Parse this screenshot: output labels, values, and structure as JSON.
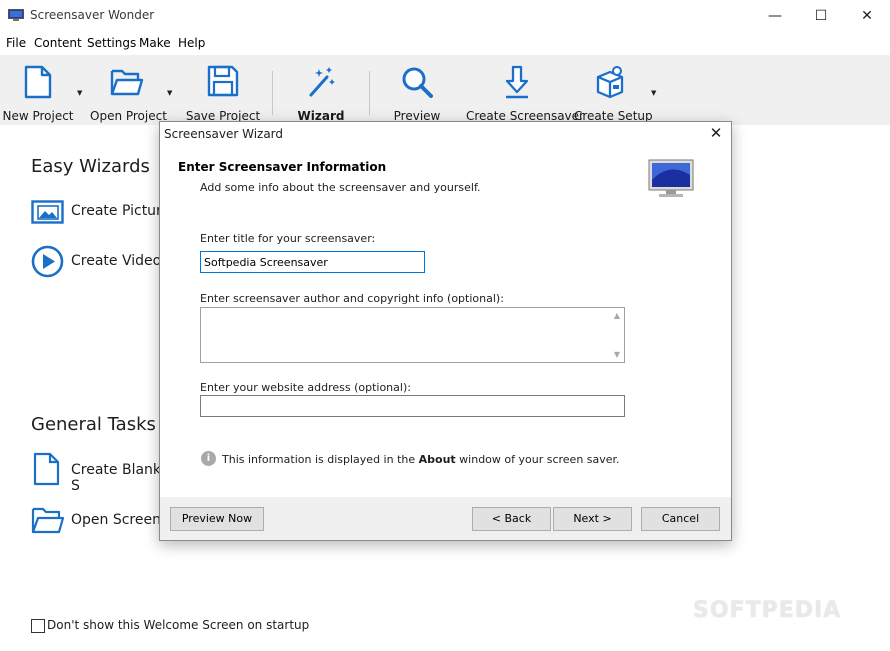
{
  "window": {
    "title": "Screensaver Wonder",
    "minimize_glyph": "—",
    "maximize_glyph": "☐",
    "close_glyph": "✕"
  },
  "menu": [
    "File",
    "Content",
    "Settings",
    "Make",
    "Help"
  ],
  "toolbar": {
    "new_project": "New Project",
    "open_project": "Open Project",
    "save_project": "Save Project",
    "wizard": "Wizard",
    "preview": "Preview",
    "create_screensaver": "Create Screensaver",
    "create_setup": "Create Setup",
    "dropdown_glyph": "▼"
  },
  "welcome": {
    "easy_wizards_title": "Easy Wizards",
    "create_picture": "Create Picture",
    "create_video": "Create Video",
    "general_tasks_title": "General Tasks",
    "create_blank": "Create Blank S",
    "open_screensaver": "Open Screens",
    "startup_checkbox_label": "Don't show this Welcome Screen on startup"
  },
  "watermark": "SOFTPEDIA",
  "dialog": {
    "title": "Screensaver Wizard",
    "close_glyph": "✕",
    "heading": "Enter Screensaver Information",
    "subheading": "Add some info about the screensaver and yourself.",
    "title_label": "Enter title for your screensaver:",
    "title_value": "Softpedia Screensaver",
    "author_label": "Enter screensaver author and copyright info (optional):",
    "author_value": "",
    "website_label": "Enter your website address (optional):",
    "website_value": "",
    "info_icon_glyph": "i",
    "info_prefix": "This information is displayed in the ",
    "info_bold": "About",
    "info_suffix": " window of your screen saver.",
    "preview_now": "Preview Now",
    "back": "< Back",
    "next": "Next >",
    "cancel": "Cancel"
  },
  "colors": {
    "accent": "#1a6fc9",
    "toolbar_bg": "#f0f0f0",
    "focus_border": "#0078d7"
  }
}
